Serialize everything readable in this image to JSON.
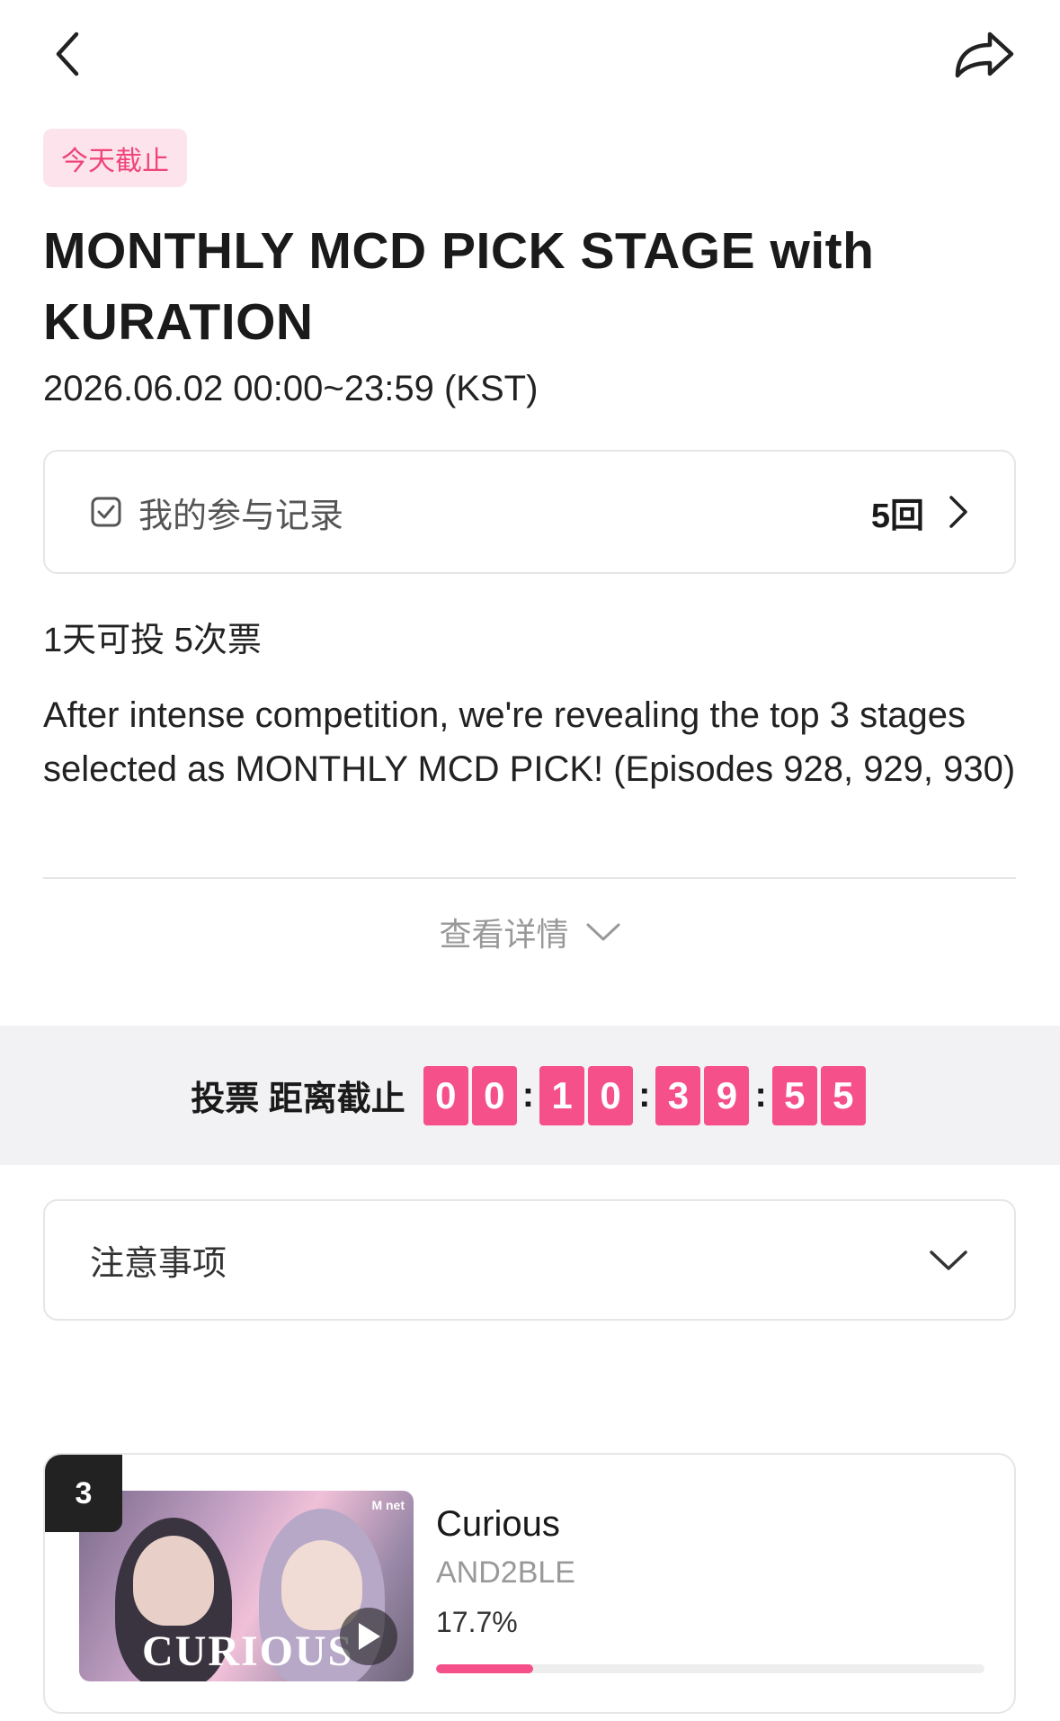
{
  "header": {
    "back_icon": "chevron-left-icon",
    "share_icon": "share-arrow-icon"
  },
  "event": {
    "deadline_badge": "今天截止",
    "title": "MONTHLY MCD PICK STAGE with KURATION",
    "date": "2026.06.02 00:00~23:59 (KST)"
  },
  "participation": {
    "label": "我的参与记录",
    "count": "5回",
    "icon": "checkbox-icon"
  },
  "vote_rule": "1天可投 5次票",
  "description": "After intense competition, we're revealing the top 3 stages selected as MONTHLY MCD PICK! (Episodes 928, 929, 930)",
  "detail_toggle": "查看详情",
  "countdown": {
    "label": "投票 距离截止",
    "digits": [
      "0",
      "0",
      "1",
      "0",
      "3",
      "9",
      "5",
      "5"
    ]
  },
  "notice": {
    "label": "注意事项"
  },
  "candidate": {
    "rank": "3",
    "thumbnail_text": "CURIOUS",
    "thumbnail_logo": "M net",
    "song": "Curious",
    "artist": "AND2BLE",
    "percent_label": "17.7%",
    "percent_value": 17.7
  },
  "colors": {
    "accent": "#f5508a",
    "badge_bg": "#fde4ec",
    "badge_text": "#f0447a"
  }
}
